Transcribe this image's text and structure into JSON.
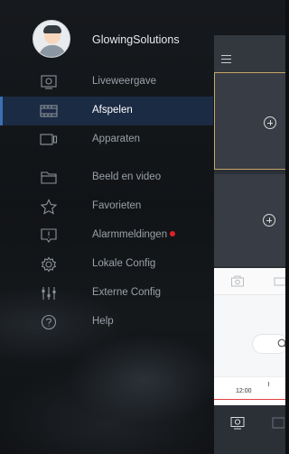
{
  "profile": {
    "username": "GlowingSolutions"
  },
  "menu": {
    "items": [
      {
        "label": "Liveweergave",
        "icon": "monitor-icon",
        "active": false
      },
      {
        "label": "Afspelen",
        "icon": "film-icon",
        "active": true
      },
      {
        "label": "Apparaten",
        "icon": "device-icon",
        "active": false
      },
      {
        "label": "Beeld en video",
        "icon": "folder-icon",
        "active": false
      },
      {
        "label": "Favorieten",
        "icon": "star-icon",
        "active": false
      },
      {
        "label": "Alarmmeldingen",
        "icon": "alarm-icon",
        "active": false,
        "badge": true
      },
      {
        "label": "Lokale Config",
        "icon": "gear-icon",
        "active": false
      },
      {
        "label": "Externe Config",
        "icon": "sliders-icon",
        "active": false
      },
      {
        "label": "Help",
        "icon": "help-icon",
        "active": false
      }
    ]
  },
  "playback_panel": {
    "timeline_time": "12:00"
  },
  "colors": {
    "accent": "#3c6fb4",
    "active_bg": "#1b2b44",
    "badge": "#e0212b",
    "selected_cell_border": "#c7a76a"
  }
}
